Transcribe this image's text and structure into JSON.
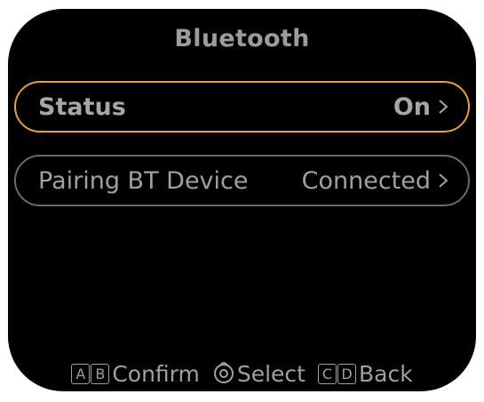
{
  "screen": {
    "title": "Bluetooth"
  },
  "menu": {
    "items": [
      {
        "label": "Status",
        "value": "On",
        "selected": true
      },
      {
        "label": "Pairing BT Device",
        "value": "Connected",
        "selected": false
      }
    ]
  },
  "footer": {
    "confirm_keys": [
      "A",
      "B"
    ],
    "confirm_label": "Confirm",
    "select_label": "Select",
    "back_keys": [
      "C",
      "D"
    ],
    "back_label": "Back"
  },
  "colors": {
    "background": "#000000",
    "highlight": "#e6a03c",
    "text": "#a6a6a6"
  }
}
